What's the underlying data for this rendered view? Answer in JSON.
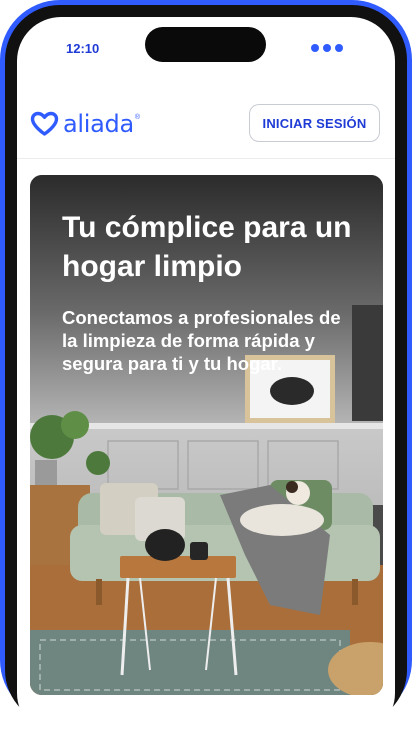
{
  "status_bar": {
    "time": "12:10"
  },
  "header": {
    "brand": "aliada",
    "brand_mark": "®",
    "login_label": "INICIAR SESIÓN"
  },
  "hero": {
    "title": "Tu cómplice para un hogar limpio",
    "subtitle": "Conectamos a profesionales de la limpieza de forma rápida y segura para ti y tu hogar."
  },
  "icons": {
    "logo": "heart-outline-icon",
    "status": "more-dots-icon"
  },
  "colors": {
    "accent": "#2f5bff",
    "frame": "#2f5bff",
    "button_text": "#1f3bd6"
  }
}
